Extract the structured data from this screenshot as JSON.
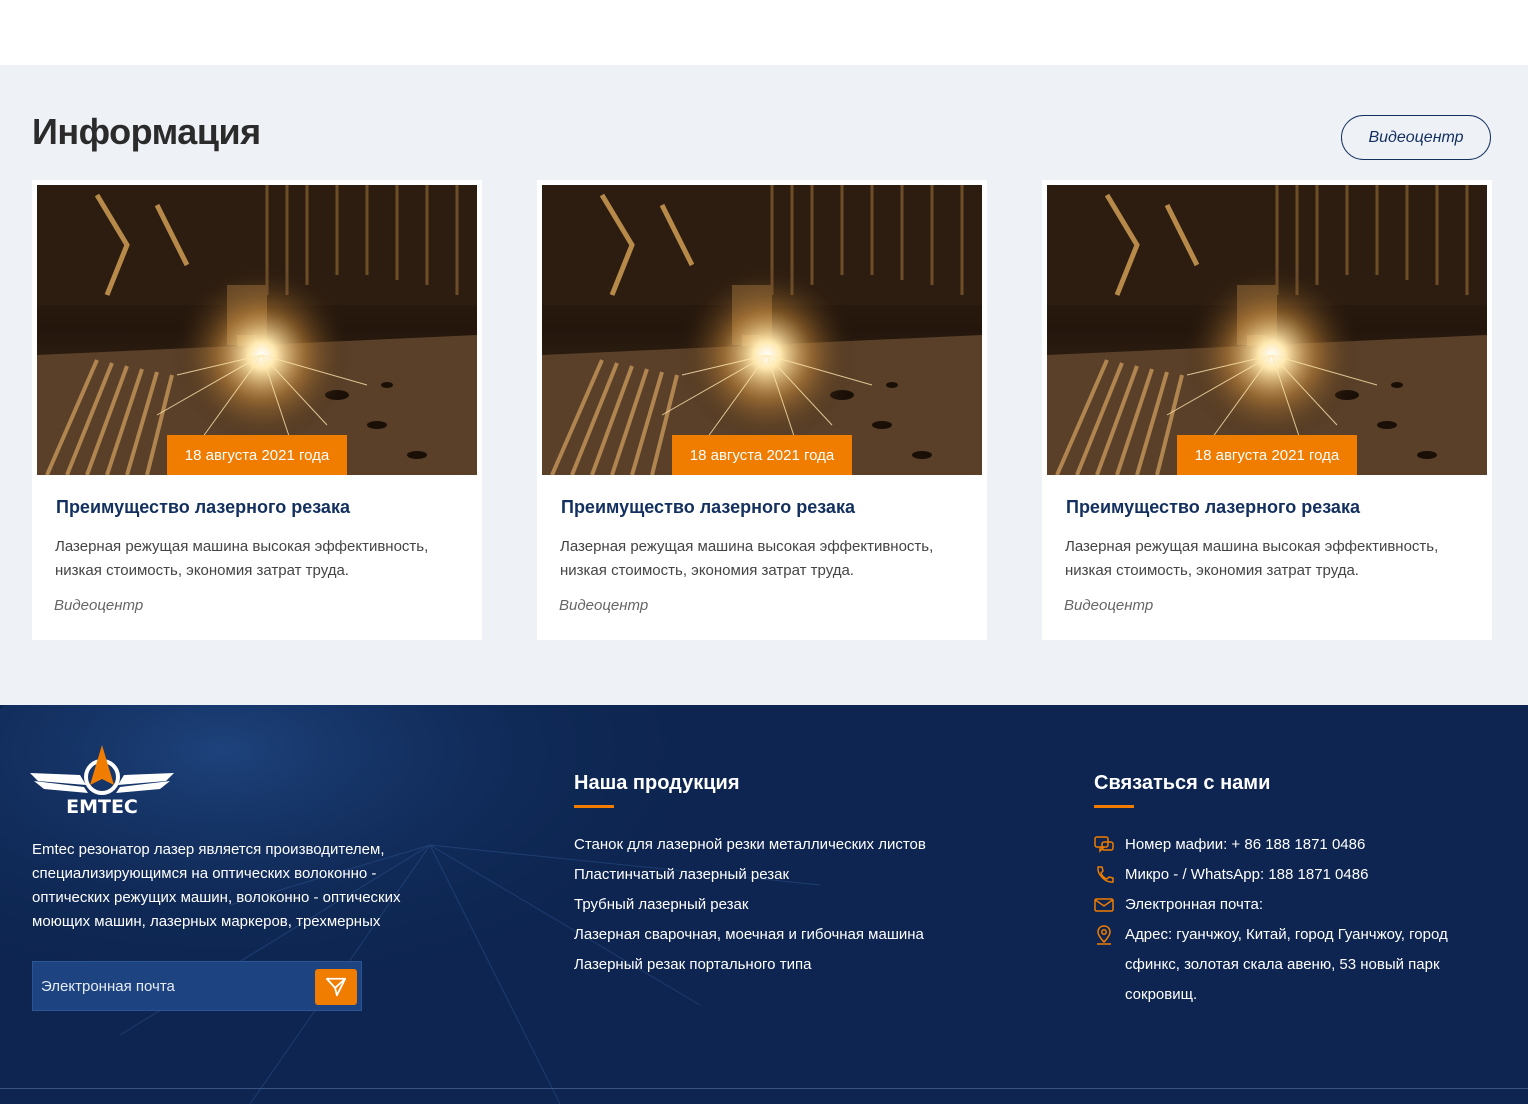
{
  "info": {
    "title": "Информация",
    "video_button": "Видеоцентр",
    "cards": [
      {
        "date": "18 августа 2021 года",
        "title": "Преимущество лазерного резака",
        "desc": "Лазерная режущая машина высокая эффективность, низкая стоимость, экономия затрат труда.",
        "link": "Видеоцентр",
        "image": "laser-cutting-photo"
      },
      {
        "date": "18 августа 2021 года",
        "title": "Преимущество лазерного резака",
        "desc": "Лазерная режущая машина высокая эффективность, низкая стоимость, экономия затрат труда.",
        "link": "Видеоцентр",
        "image": "laser-cutting-photo"
      },
      {
        "date": "18 августа 2021 года",
        "title": "Преимущество лазерного резака",
        "desc": "Лазерная режущая машина высокая эффективность, низкая стоимость, экономия затрат труда.",
        "link": "Видеоцентр",
        "image": "laser-cutting-photo"
      }
    ]
  },
  "footer": {
    "logo_text": "EMTEC",
    "about": "Emtec резонатор лазер является производителем, специализирующимся на оптических волоконно - оптических режущих машин, волоконно - оптических моющих машин, лазерных маркеров, трехмерных",
    "email_placeholder": "Электронная почта",
    "products_title": "Наша продукция",
    "products": [
      "Станок для лазерной резки металлических листов",
      "Пластинчатый лазерный резак",
      "Трубный лазерный резак",
      "Лазерная сварочная, моечная и гибочная машина",
      "Лазерный резак портального типа"
    ],
    "contact_title": "Связаться с нами",
    "contacts": [
      {
        "icon": "chat-icon",
        "text": "Номер мафии: + 86 188 1871 0486"
      },
      {
        "icon": "phone-icon",
        "text": "Микро - / WhatsApp: 188 1871 0486"
      },
      {
        "icon": "mail-icon",
        "text": "Электронная почта:"
      },
      {
        "icon": "location-icon",
        "text": "Адрес: гуанчжоу, Китай, город Гуанчжоу, город сфинкс, золотая скала авеню, 53 новый парк сокровищ."
      }
    ]
  },
  "colors": {
    "accent": "#f07c00",
    "navy": "#13305f",
    "footer_bg": "#0d2550",
    "section_bg": "#eef1f6"
  }
}
